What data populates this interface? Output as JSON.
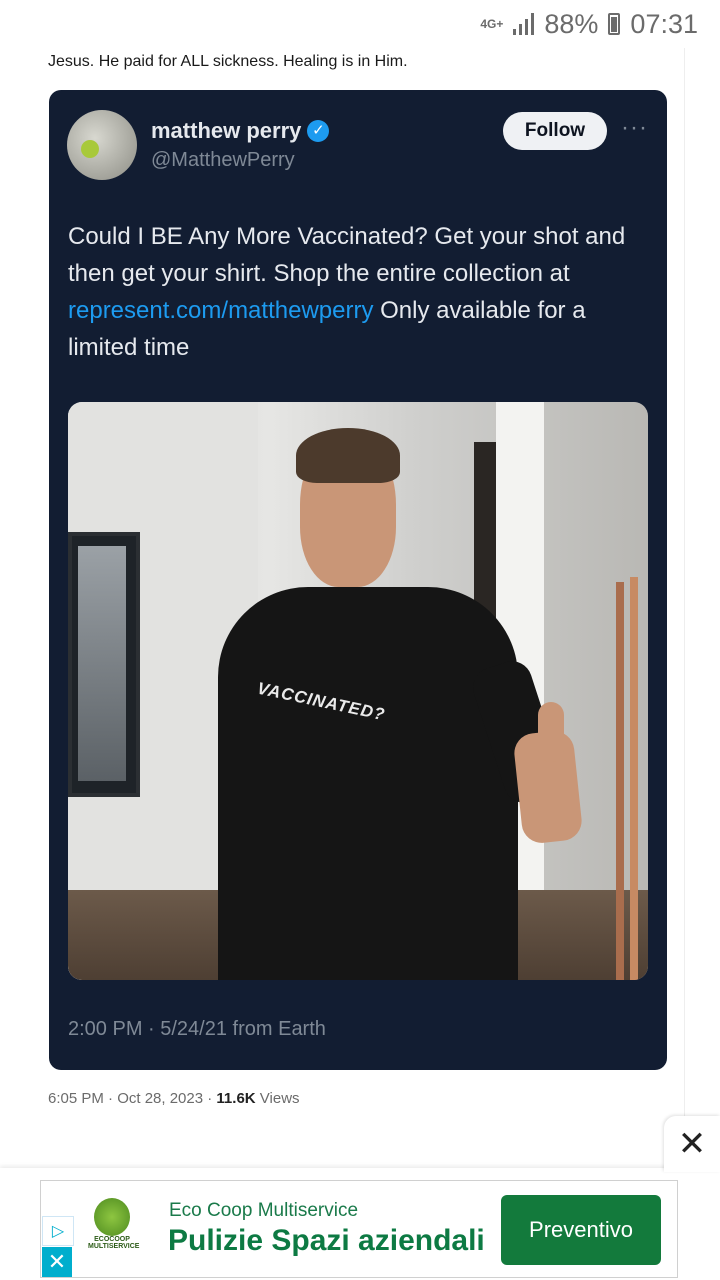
{
  "status_bar": {
    "network": "4G+",
    "battery": "88%",
    "time": "07:31"
  },
  "post": {
    "top_text": "Jesus. He paid for ALL sickness. Healing is in Him.",
    "date": "6:05 PM · Oct 28, 2023 · ",
    "views_count": "11.6K",
    "views_label": " Views"
  },
  "embedded_tweet": {
    "name": "matthew perry",
    "handle": "@MatthewPerry",
    "follow_label": "Follow",
    "more_label": "···",
    "text_before_link": "Could I BE Any More Vaccinated? Get your shot and then get your shirt. Shop the entire collection at ",
    "link": "represent.com/matthewperry",
    "text_after_link": " Only available for a limited time",
    "shirt_text": "VACCINATED?",
    "meta": "2:00 PM · 5/24/21 from Earth"
  },
  "ad": {
    "close_label": "✕",
    "brand": "Eco Coop Multiservice",
    "headline": "Pulizie Spazi aziendali",
    "cta": "Preventivo",
    "logo_text": "ECOCOOP MULTISERVICE",
    "adchoices_label": "▷",
    "ad_close_label": "✕"
  },
  "colors": {
    "card_bg": "#121d32",
    "link": "#1d9bf0",
    "cta_green": "#137a3c"
  }
}
